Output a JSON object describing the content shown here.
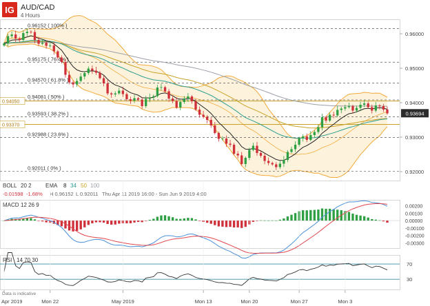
{
  "brand": {
    "logo_text": "IG",
    "logo_color": "#d7281b"
  },
  "header": {
    "symbol": "AUD/CAD",
    "timeframe": "4 Hours"
  },
  "colors": {
    "candle_up": "#2ea043",
    "candle_down": "#d0303a",
    "boll": "#f2a93b",
    "boll_fill": "#fdf3dc",
    "ema8": "#222222",
    "ema34": "#2a9d8f",
    "ema50": "#c9a227",
    "ema100": "#9aa0a8",
    "macd_line": "#4a90d9",
    "signal_line": "#e0454c",
    "rsi_line": "#333333",
    "rsi_band": "#3a8fa0",
    "price_box": "#2b2b2b",
    "hline_gold": "#c8a028"
  },
  "chart_data": [
    {
      "type": "candlestick",
      "title": "AUD/CAD",
      "subtitle": "4 Hours",
      "x_ticks": [
        "Apr 2019",
        "Mon 22",
        "May 2019",
        "Mon 13",
        "Mon 20",
        "Mon 27",
        "Mon 3"
      ],
      "x_tick_candle_index": [
        0,
        12,
        31,
        52,
        64,
        77,
        89
      ],
      "y_ticks": [
        0.96,
        0.95,
        0.94,
        0.93,
        0.92
      ],
      "y_tick_labels": [
        "0.96000",
        "0.95000",
        "0.94000",
        "0.93000",
        "0.92000"
      ],
      "ylim": [
        0.9176,
        0.9638
      ],
      "last_price": 0.93694,
      "last_price_label": "0.93694",
      "fib_levels": [
        {
          "value": 0.96152,
          "label": "0.96152 ( 100% )"
        },
        {
          "value": 0.95175,
          "label": "0.95175 ( 76.4% )"
        },
        {
          "value": 0.9457,
          "label": "0.94570 ( 61.8% )"
        },
        {
          "value": 0.94081,
          "label": "0.94081 ( 50% )"
        },
        {
          "value": 0.93593,
          "label": "0.93593 ( 38.2% )"
        },
        {
          "value": 0.92988,
          "label": "0.92988 ( 23.6% )"
        },
        {
          "value": 0.92011,
          "label": "0.92011 ( 0% )"
        }
      ],
      "hlines": [
        {
          "value": 0.9405,
          "label": "0.94050"
        },
        {
          "value": 0.9337,
          "label": "0.93370"
        }
      ],
      "indicator_legend": {
        "boll": "BOLL",
        "boll_params": "20  2",
        "ema": "EMA",
        "ema_periods": [
          "8",
          "34",
          "50",
          "100"
        ]
      },
      "info_line": {
        "change": "-0.01598",
        "change_pct": "-1.68%",
        "high": "H 0.96152",
        "low": "L 0.92011",
        "range": "Thu Apr 11 2019 16:00 - Sun Jun 9 2019 4:00"
      },
      "closes": [
        0.9572,
        0.9593,
        0.9598,
        0.9586,
        0.9582,
        0.9602,
        0.9606,
        0.9605,
        0.9582,
        0.9571,
        0.9574,
        0.9565,
        0.9566,
        0.9549,
        0.9531,
        0.9518,
        0.9481,
        0.9459,
        0.9453,
        0.9463,
        0.9476,
        0.9486,
        0.9499,
        0.9493,
        0.9487,
        0.9471,
        0.9456,
        0.9427,
        0.9424,
        0.9427,
        0.9435,
        0.9425,
        0.941,
        0.9406,
        0.9413,
        0.9409,
        0.939,
        0.9411,
        0.9415,
        0.9419,
        0.9444,
        0.9445,
        0.9433,
        0.9412,
        0.9405,
        0.9386,
        0.9402,
        0.9412,
        0.9418,
        0.9404,
        0.938,
        0.9365,
        0.9359,
        0.935,
        0.9334,
        0.9312,
        0.9295,
        0.9296,
        0.9281,
        0.9278,
        0.9252,
        0.9247,
        0.9222,
        0.924,
        0.9263,
        0.9275,
        0.9254,
        0.9246,
        0.9231,
        0.9225,
        0.9221,
        0.9213,
        0.9223,
        0.9234,
        0.9257,
        0.9265,
        0.9278,
        0.9297,
        0.9302,
        0.9292,
        0.9306,
        0.9315,
        0.9329,
        0.9358,
        0.9348,
        0.9365,
        0.9363,
        0.9379,
        0.9383,
        0.9387,
        0.939,
        0.9377,
        0.9385,
        0.9394,
        0.9398,
        0.9387,
        0.9377,
        0.9392,
        0.939,
        0.938,
        0.9369
      ]
    },
    {
      "type": "macd",
      "label": "MACD",
      "params": "12  26  9",
      "y_ticks": [
        0.002,
        0.001,
        0,
        -0.001,
        -0.002,
        -0.003
      ],
      "y_tick_labels": [
        "0.00200",
        "0.00100",
        "0.00000",
        "-0.00100",
        "-0.00200",
        "-0.00300"
      ],
      "ylim": [
        -0.0036,
        0.0026
      ]
    },
    {
      "type": "rsi",
      "label": "RSI",
      "params": "14  70  30",
      "y_ticks": [
        70,
        30
      ],
      "y_tick_labels": [
        "70",
        "30"
      ],
      "ylim": [
        0,
        100
      ]
    }
  ],
  "footer": {
    "note": "Data is indicative"
  }
}
